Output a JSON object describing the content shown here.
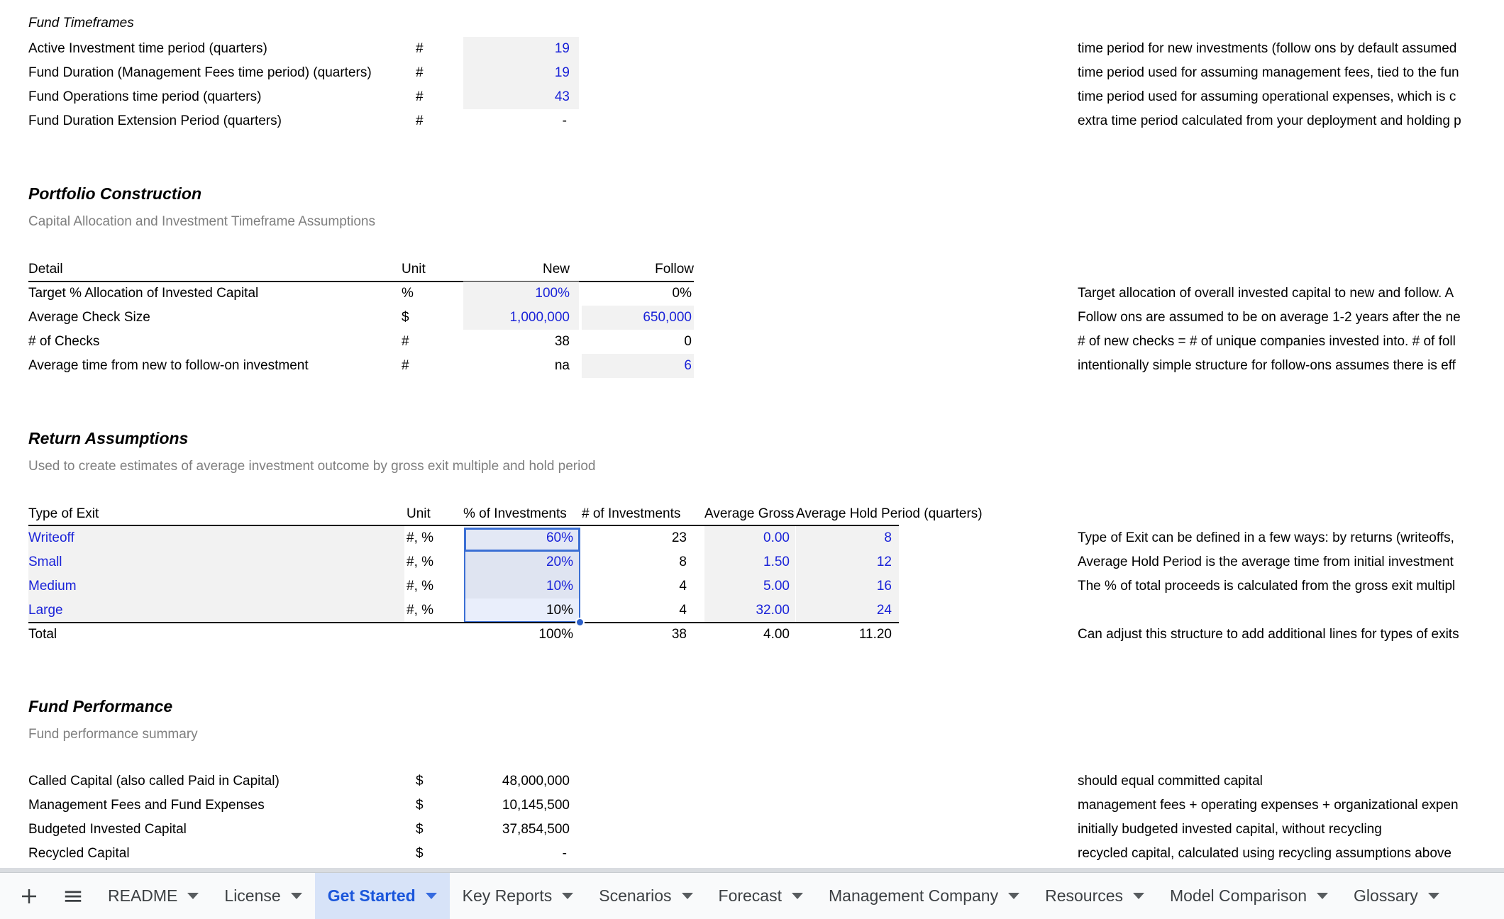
{
  "sheet": {
    "fund_timeframes": {
      "group_title": "Fund Timeframes",
      "rows": [
        {
          "label": "Active Investment time period (quarters)",
          "unit": "#",
          "value": "19",
          "desc": "time period for new investments (follow ons by default assumed"
        },
        {
          "label": "Fund Duration (Management Fees time period) (quarters)",
          "unit": "#",
          "value": "19",
          "desc": "time period used for assuming management fees, tied to the fun"
        },
        {
          "label": "Fund Operations time period (quarters)",
          "unit": "#",
          "value": "43",
          "desc": "time period used for assuming operational expenses, which is c"
        },
        {
          "label": "Fund Duration Extension Period (quarters)",
          "unit": "#",
          "value": "-",
          "desc": "extra time period calculated from your deployment and holding p"
        }
      ]
    },
    "portfolio_construction": {
      "title": "Portfolio Construction",
      "subtitle": "Capital Allocation and Investment Timeframe Assumptions",
      "headers": {
        "detail": "Detail",
        "unit": "Unit",
        "new": "New",
        "follow": "Follow"
      },
      "rows": [
        {
          "label": "Target % Allocation of Invested Capital",
          "unit": "%",
          "new": "100%",
          "follow": "0%",
          "desc": "Target allocation of overall invested capital to new and follow. A"
        },
        {
          "label": "Average Check Size",
          "unit": "$",
          "new": "1,000,000",
          "follow": "650,000",
          "desc": "Follow ons are assumed to be on average 1-2 years after the ne"
        },
        {
          "label": "# of Checks",
          "unit": "#",
          "new": "38",
          "follow": "0",
          "desc": "# of new checks = # of unique companies invested into. # of foll"
        },
        {
          "label": "Average time from new to follow-on investment",
          "unit": "#",
          "new": "na",
          "follow": "6",
          "desc": "intentionally simple structure for follow-ons assumes there is eff"
        }
      ]
    },
    "return_assumptions": {
      "title": "Return Assumptions",
      "subtitle": "Used to create estimates of average investment outcome by gross exit multiple and hold period",
      "headers": {
        "type": "Type of Exit",
        "unit": "Unit",
        "pct_investments": "% of Investments",
        "num_investments": "# of Investments",
        "avg_gross": "Average Gross",
        "avg_hold": "Average Hold Period (quarters)"
      },
      "rows": [
        {
          "label": "Writeoff",
          "unit": "#, %",
          "pct": "60%",
          "count": "23",
          "gross": "0.00",
          "hold": "8",
          "desc": "Type of Exit can be defined in a few ways: by returns (writeoffs,"
        },
        {
          "label": "Small",
          "unit": "#, %",
          "pct": "20%",
          "count": "8",
          "gross": "1.50",
          "hold": "12",
          "desc": "Average Hold Period is the average time from initial investment"
        },
        {
          "label": "Medium",
          "unit": "#, %",
          "pct": "10%",
          "count": "4",
          "gross": "5.00",
          "hold": "16",
          "desc": "The % of total proceeds is calculated from the gross exit multipl"
        },
        {
          "label": "Large",
          "unit": "#, %",
          "pct": "10%",
          "count": "4",
          "gross": "32.00",
          "hold": "24",
          "desc": ""
        }
      ],
      "total": {
        "label": "Total",
        "unit": "",
        "pct": "100%",
        "count": "38",
        "gross": "4.00",
        "hold": "11.20",
        "desc": "Can adjust this structure to add additional lines for types of exits"
      }
    },
    "fund_performance": {
      "title": "Fund Performance",
      "subtitle": "Fund performance summary",
      "rows": [
        {
          "label": "Called Capital (also called Paid in Capital)",
          "unit": "$",
          "value": "48,000,000",
          "desc": "should equal committed capital"
        },
        {
          "label": "Management Fees and Fund Expenses",
          "unit": "$",
          "value": "10,145,500",
          "desc": "management fees + operating expenses + organizational expen"
        },
        {
          "label": "Budgeted Invested Capital",
          "unit": "$",
          "value": "37,854,500",
          "desc": "initially budgeted invested capital, without recycling"
        },
        {
          "label": "Recycled Capital",
          "unit": "$",
          "value": "-",
          "desc": "recycled capital, calculated using recycling assumptions above"
        }
      ]
    }
  },
  "tabbar": {
    "add_sheet_label": "+",
    "all_sheets_label": "All sheets",
    "tabs": [
      {
        "name": "README",
        "active": false
      },
      {
        "name": "License",
        "active": false
      },
      {
        "name": "Get Started",
        "active": true
      },
      {
        "name": "Key Reports",
        "active": false
      },
      {
        "name": "Scenarios",
        "active": false
      },
      {
        "name": "Forecast",
        "active": false
      },
      {
        "name": "Management Company",
        "active": false
      },
      {
        "name": "Resources",
        "active": false
      },
      {
        "name": "Model Comparison",
        "active": false
      },
      {
        "name": "Glossary",
        "active": false
      }
    ]
  },
  "colors": {
    "value_blue": "#1a23d8",
    "selection_border": "#3b6fd4",
    "selection_tint": "#dfe4f1",
    "cell_shade": "#f2f2f2",
    "active_tab_bg": "#d7e3f8",
    "active_tab_text": "#1a56db"
  }
}
